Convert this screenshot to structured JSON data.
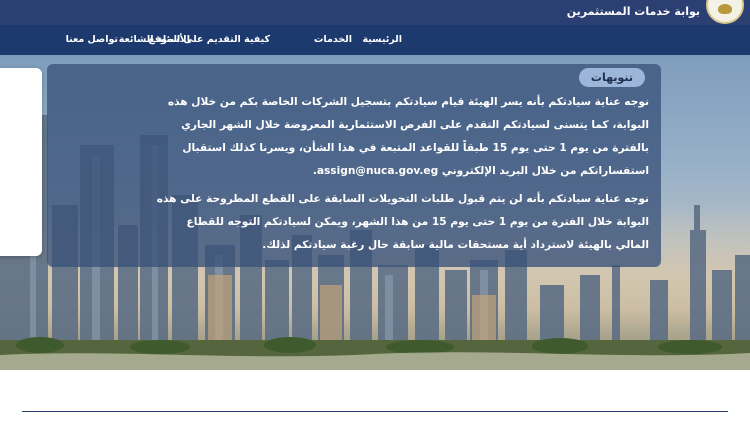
{
  "header": {
    "portal_title": "بوابة خدمات المستثمرين",
    "logo_icon": "emblem-logo-icon",
    "bg_color": "#2b3f73"
  },
  "nav": {
    "bg_color": "#1d3a6e",
    "items": [
      {
        "label": "الرئيسية"
      },
      {
        "label": "الخدمات"
      },
      {
        "label": "كيفية التقديم على الموقع"
      },
      {
        "label": "الأسئلة الشائعة"
      },
      {
        "label": "تواصل معنا"
      }
    ]
  },
  "notice": {
    "badge": "تنويهات",
    "paragraph1": [
      "نوجه عناية سيادتكم بأنه يسر الهيئة قيام سيادتكم بتسجيل الشركات الخاصة بكم من خلال هذه",
      "البوابة، كما يتسنى لسيادتكم التقدم على الفرص الاستثمارية المعروضة خلال الشهر الجاري",
      "بالفترة من يوم 1 حتى يوم 15 طبقاً للقواعد المتبعة في هذا الشأن، ويسرنا كذلك استقبال",
      "استفساراتكم من خلال البريد الإلكتروني assign@nuca.gov.eg."
    ],
    "paragraph2": [
      "نوجه عناية سيادتكم بأنه لن يتم قبول طلبات التحويلات السابقة على القطع المطروحة على هذه",
      "البوابة خلال الفترة من يوم 1 حتى يوم 15 من هذا الشهر، ويمكن لسيادتكم التوجه للقطاع",
      "المالي بالهيئة لاسترداد أية مستحقات مالية سابقة حال رغبة سيادتكم لذلك."
    ]
  }
}
